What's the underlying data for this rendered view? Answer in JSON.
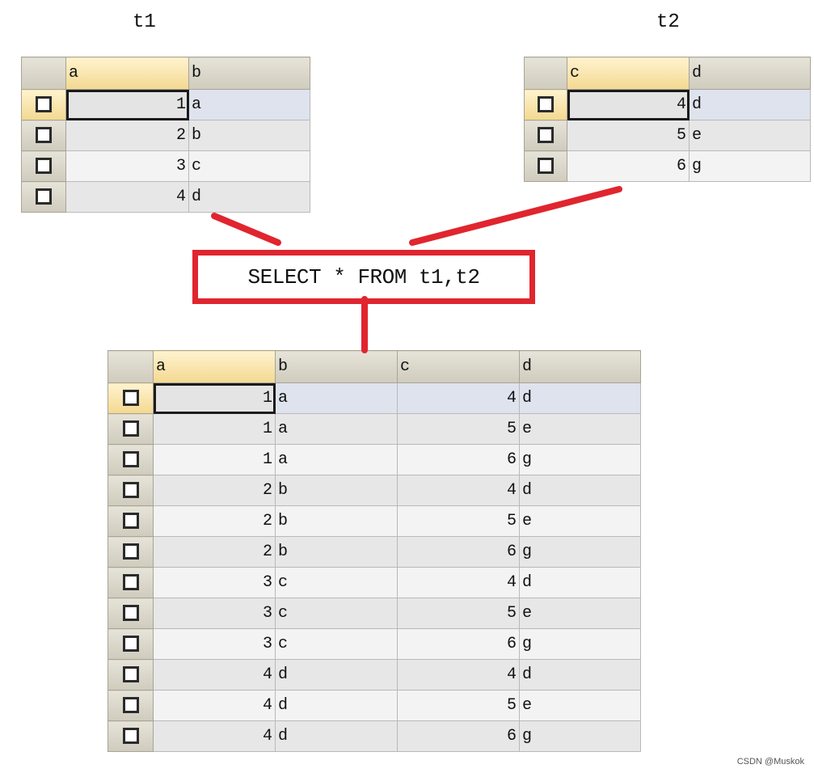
{
  "t1": {
    "label": "t1",
    "columns": [
      "a",
      "b"
    ],
    "rows": [
      [
        "1",
        "a"
      ],
      [
        "2",
        "b"
      ],
      [
        "3",
        "c"
      ],
      [
        "4",
        "d"
      ]
    ]
  },
  "t2": {
    "label": "t2",
    "columns": [
      "c",
      "d"
    ],
    "rows": [
      [
        "4",
        "d"
      ],
      [
        "5",
        "e"
      ],
      [
        "6",
        "g"
      ]
    ]
  },
  "query": {
    "text": "SELECT * FROM t1,t2"
  },
  "result": {
    "columns": [
      "a",
      "b",
      "c",
      "d"
    ],
    "rows": [
      [
        "1",
        "a",
        "4",
        "d"
      ],
      [
        "1",
        "a",
        "5",
        "e"
      ],
      [
        "1",
        "a",
        "6",
        "g"
      ],
      [
        "2",
        "b",
        "4",
        "d"
      ],
      [
        "2",
        "b",
        "5",
        "e"
      ],
      [
        "2",
        "b",
        "6",
        "g"
      ],
      [
        "3",
        "c",
        "4",
        "d"
      ],
      [
        "3",
        "c",
        "5",
        "e"
      ],
      [
        "3",
        "c",
        "6",
        "g"
      ],
      [
        "4",
        "d",
        "4",
        "d"
      ],
      [
        "4",
        "d",
        "5",
        "e"
      ],
      [
        "4",
        "d",
        "6",
        "g"
      ]
    ]
  },
  "colors": {
    "connector": "#e0252f"
  },
  "watermark": "CSDN @Muskok"
}
